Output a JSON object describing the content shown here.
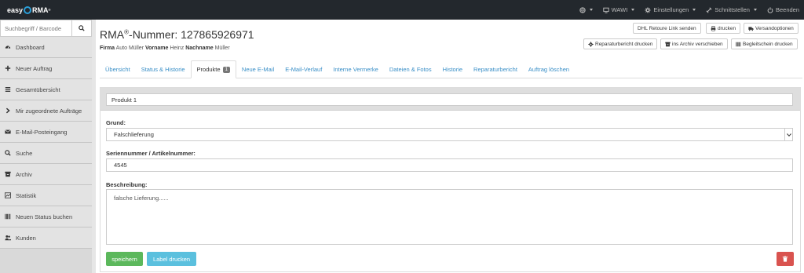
{
  "brand": {
    "left": "easy",
    "right": "RMA",
    "mark": "®"
  },
  "topnav": {
    "globe_caret": "",
    "wawi": "WAWI",
    "settings": "Einstellungen",
    "interfaces": "Schnittstellen",
    "logout": "Beenden"
  },
  "sidebar": {
    "search_placeholder": "Suchbegriff / Barcode",
    "items": [
      {
        "label": "Dashboard",
        "icon": "dashboard-icon"
      },
      {
        "label": "Neuer Auftrag",
        "icon": "plus-icon"
      },
      {
        "label": "Gesamtübersicht",
        "icon": "list-icon"
      },
      {
        "label": "Mir zugeordnete Aufträge",
        "icon": "chevron-right-icon"
      },
      {
        "label": "E-Mail-Posteingang",
        "icon": "envelope-icon"
      },
      {
        "label": "Suche",
        "icon": "search-icon"
      },
      {
        "label": "Archiv",
        "icon": "archive-icon"
      },
      {
        "label": "Statistik",
        "icon": "chart-icon"
      },
      {
        "label": "Neuen Status buchen",
        "icon": "barcode-icon"
      },
      {
        "label": "Kunden",
        "icon": "users-icon"
      }
    ]
  },
  "header": {
    "title_prefix": "RMA",
    "title_mark": "®",
    "title_rest": "-Nummer: 127865926971",
    "firma_label": "Firma",
    "firma": "Auto Müller",
    "vorname_label": "Vorname",
    "vorname": "Heinz",
    "nachname_label": "Nachname",
    "nachname": "Müller"
  },
  "actions": {
    "dhl": "DHL Retoure Link senden",
    "print": "drucken",
    "shipping": "Versandoptionen",
    "repair_report": "Reparaturbericht drucken",
    "archive": "ins Archiv verschieben",
    "slip": "Begleitschein drucken"
  },
  "tabs": [
    {
      "label": "Übersicht"
    },
    {
      "label": "Status & Historie"
    },
    {
      "label": "Produkte",
      "badge": "1"
    },
    {
      "label": "Neue E-Mail"
    },
    {
      "label": "E-Mail-Verlauf"
    },
    {
      "label": "Interne Vermerke"
    },
    {
      "label": "Dateien & Fotos"
    },
    {
      "label": "Historie"
    },
    {
      "label": "Reparaturbericht"
    },
    {
      "label": "Auftrag löschen"
    }
  ],
  "form": {
    "product_name": "Produkt 1",
    "reason_label": "Grund:",
    "reason_value": "Falschlieferung",
    "serial_label": "Seriennummer / Artikelnummer:",
    "serial_value": "4545",
    "description_label": "Beschreibung:",
    "description_value": "falsche Lieferung......",
    "save_label": "speichern",
    "print_label": "Label drucken"
  },
  "colors": {
    "accent": "#3a8fc7",
    "save": "#5cb85c",
    "label": "#5bc0de",
    "delete": "#d9534f"
  }
}
